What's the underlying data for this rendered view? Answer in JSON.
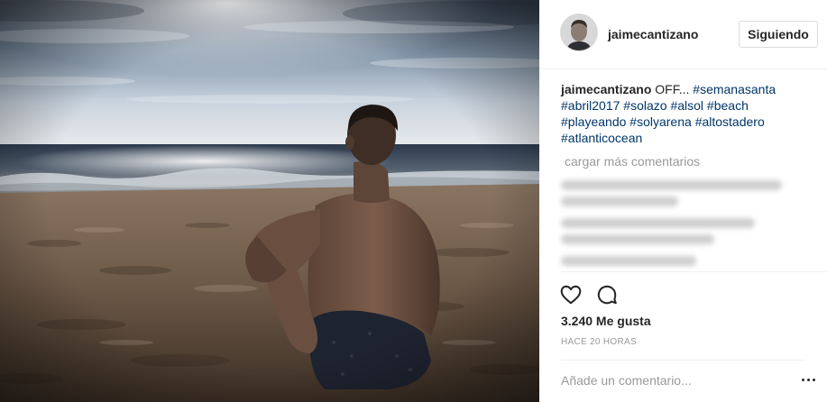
{
  "post": {
    "username": "jaimecantizano",
    "follow_button": "Siguiendo",
    "caption": {
      "user": "jaimecantizano",
      "text": "OFF...",
      "hashtags": [
        "#semanasanta",
        "#abril2017",
        "#solazo",
        "#alsol",
        "#beach",
        "#playeando",
        "#solyarena",
        "#altostadero",
        "#atlanticocean"
      ]
    },
    "load_more": "cargar más comentarios",
    "likes": "3.240 Me gusta",
    "timestamp": "HACE 20 HORAS",
    "comment_placeholder": "Añade un comentario...",
    "icons": {
      "like": "heart-icon",
      "comment": "speech-bubble-icon",
      "more": "ellipsis-icon"
    }
  },
  "colors": {
    "text": "#262626",
    "hashtag": "#003569",
    "muted": "#999999",
    "border": "#dbdbdb"
  }
}
